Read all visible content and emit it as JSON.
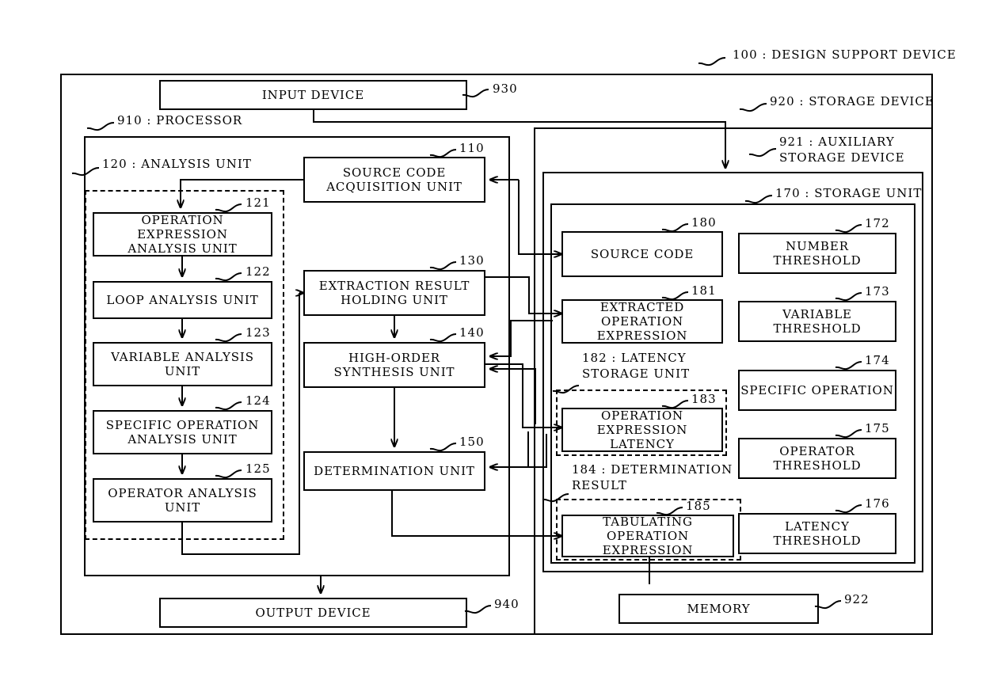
{
  "figure": {
    "type": "block-diagram",
    "title_ref": "100 : DESIGN SUPPORT DEVICE"
  },
  "outer": {
    "device_label": "100 : DESIGN SUPPORT DEVICE"
  },
  "top": {
    "input_device": "INPUT DEVICE",
    "input_device_ref": "930",
    "processor_label": "910 : PROCESSOR",
    "storage_device_label": "920 : STORAGE DEVICE"
  },
  "processor": {
    "analysis_unit_label": "120 : ANALYSIS UNIT",
    "analysis_units": [
      {
        "ref": "121",
        "label": "OPERATION EXPRESSION\nANALYSIS UNIT"
      },
      {
        "ref": "122",
        "label": "LOOP ANALYSIS UNIT"
      },
      {
        "ref": "123",
        "label": "VARIABLE ANALYSIS\nUNIT"
      },
      {
        "ref": "124",
        "label": "SPECIFIC OPERATION\nANALYSIS UNIT"
      },
      {
        "ref": "125",
        "label": "OPERATOR ANALYSIS\nUNIT"
      }
    ],
    "pipeline": [
      {
        "ref": "110",
        "label": "SOURCE CODE\nACQUISITION UNIT"
      },
      {
        "ref": "130",
        "label": "EXTRACTION RESULT\nHOLDING UNIT"
      },
      {
        "ref": "140",
        "label": "HIGH-ORDER\nSYNTHESIS UNIT"
      },
      {
        "ref": "150",
        "label": "DETERMINATION UNIT"
      }
    ]
  },
  "storage": {
    "auxiliary_label": "921 : AUXILIARY\nSTORAGE DEVICE",
    "storage_unit_label": "170 : STORAGE UNIT",
    "left_column": [
      {
        "ref": "180",
        "label": "SOURCE CODE"
      },
      {
        "ref": "181",
        "label": "EXTRACTED OPERATION\nEXPRESSION"
      },
      {
        "ref": "183",
        "label": "OPERATION\nEXPRESSION LATENCY"
      },
      {
        "ref": "185",
        "label": "TABULATING OPERATION\nEXPRESSION"
      }
    ],
    "group_labels": [
      {
        "ref": "182",
        "label": "182 : LATENCY\nSTORAGE UNIT"
      },
      {
        "ref": "184",
        "label": "184 : DETERMINATION\nRESULT"
      }
    ],
    "right_column": [
      {
        "ref": "172",
        "label": "NUMBER THRESHOLD"
      },
      {
        "ref": "173",
        "label": "VARIABLE THRESHOLD"
      },
      {
        "ref": "174",
        "label": "SPECIFIC OPERATION"
      },
      {
        "ref": "175",
        "label": "OPERATOR THRESHOLD"
      },
      {
        "ref": "176",
        "label": "LATENCY THRESHOLD"
      }
    ],
    "memory": {
      "ref": "922",
      "label": "MEMORY"
    }
  },
  "bottom": {
    "output_device": "OUTPUT DEVICE",
    "output_device_ref": "940"
  },
  "colors": {
    "line": "#000000",
    "background": "#ffffff"
  }
}
